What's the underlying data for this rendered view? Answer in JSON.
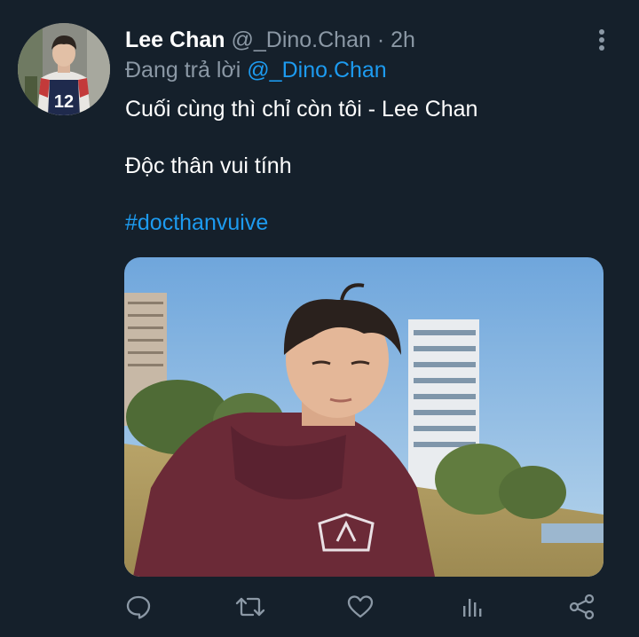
{
  "tweet": {
    "author_name": "Lee Chan",
    "author_handle": "@_Dino.Chan",
    "separator": "·",
    "time": "2h",
    "replying_prefix": "Đang trả lời",
    "replying_to": "@_Dino.Chan",
    "line1": "Cuối cùng thì chỉ còn tôi - Lee Chan",
    "line2": "Độc thân vui tính",
    "hashtag": "#docthanvuive",
    "avatar_jersey_number": "12"
  },
  "icons": {
    "more": "more-vertical-icon",
    "reply": "reply-icon",
    "retweet": "retweet-icon",
    "like": "heart-icon",
    "analytics": "analytics-icon",
    "share": "share-icon"
  },
  "colors": {
    "background": "#15202b",
    "secondary_text": "#8b98a5",
    "accent": "#1d9bf0",
    "icon": "#8b98a5"
  }
}
